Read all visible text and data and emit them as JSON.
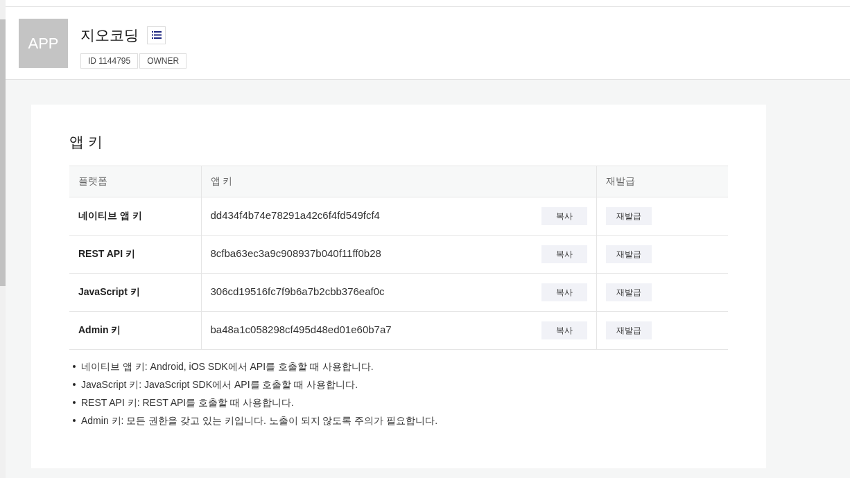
{
  "app": {
    "logo": "APP",
    "name": "지오코딩",
    "badges": [
      "ID 1144795",
      "OWNER"
    ]
  },
  "section": {
    "title": "앱 키",
    "columns": [
      "플랫폼",
      "앱 키",
      "재발급"
    ],
    "rows": [
      {
        "platform": "네이티브 앱 키",
        "key": "dd434f4b74e78291a42c6f4fd549fcf4",
        "copy": "복사",
        "reissue": "재발급"
      },
      {
        "platform": "REST API 키",
        "key": "8cfba63ec3a9c908937b040f11ff0b28",
        "copy": "복사",
        "reissue": "재발급"
      },
      {
        "platform": "JavaScript 키",
        "key": "306cd19516fc7f9b6a7b2cbb376eaf0c",
        "copy": "복사",
        "reissue": "재발급"
      },
      {
        "platform": "Admin 키",
        "key": "ba48a1c058298cf495d48ed01e60b7a7",
        "copy": "복사",
        "reissue": "재발급"
      }
    ],
    "notes": [
      "네이티브 앱 키: Android, iOS SDK에서 API를 호출할 때 사용합니다.",
      "JavaScript 키: JavaScript SDK에서 API를 호출할 때 사용합니다.",
      "REST API 키: REST API를 호출할 때 사용합니다.",
      "Admin 키: 모든 권한을 갖고 있는 키입니다. 노출이 되지 않도록 주의가 필요합니다."
    ]
  }
}
